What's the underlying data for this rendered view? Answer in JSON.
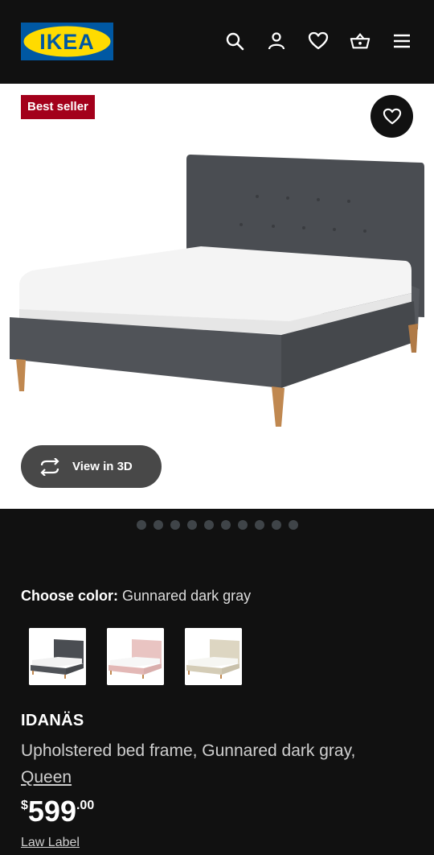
{
  "header": {
    "logo_text": "IKEA",
    "icons": [
      "search-icon",
      "user-icon",
      "heart-icon",
      "shopping-bag-icon",
      "menu-icon"
    ]
  },
  "hero": {
    "badge": "Best seller",
    "favorite_icon": "heart-outline-icon",
    "view_3d_label": "View in 3D",
    "view_3d_icon": "rotate-3d-icon",
    "image_count": 10,
    "active_image_index": 0
  },
  "color_picker": {
    "label": "Choose color:",
    "selected": "Gunnared dark gray",
    "options": [
      "Gunnared dark gray",
      "Pink",
      "Beige"
    ]
  },
  "product": {
    "name": "IDANÄS",
    "description": "Upholstered bed frame, Gunnared dark gray,",
    "size_link": "Queen",
    "price_currency": "$",
    "price_integer": "599",
    "price_decimal": ".00",
    "law_label": "Law Label"
  },
  "colors": {
    "header_bg": "#111111",
    "ikea_blue": "#0058a3",
    "ikea_yellow": "#ffdb00",
    "badge_red": "#a3001b",
    "button_gray": "#484848"
  }
}
